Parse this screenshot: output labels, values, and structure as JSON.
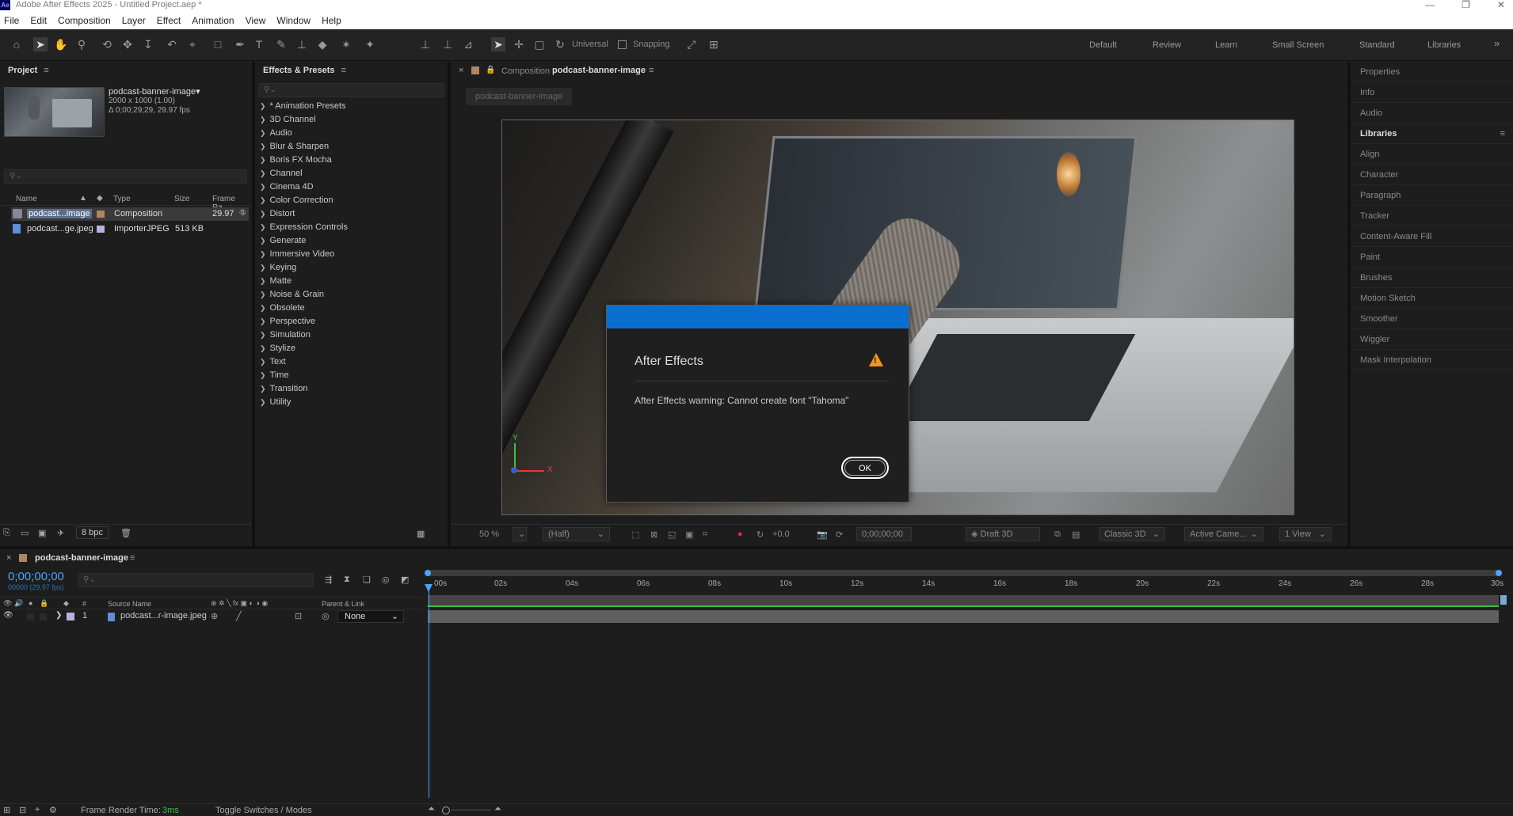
{
  "app": {
    "logo": "Ae",
    "title": "Adobe After Effects 2025 - Untitled Project.aep *",
    "window_controls": [
      "—",
      "❐",
      "✕"
    ]
  },
  "menu": [
    "File",
    "Edit",
    "Composition",
    "Layer",
    "Effect",
    "Animation",
    "View",
    "Window",
    "Help"
  ],
  "toolbar": {
    "universal_label": "Universal",
    "snapping_label": "Snapping",
    "workspaces": [
      "Default",
      "Review",
      "Learn",
      "Small Screen",
      "Standard",
      "Libraries"
    ],
    "more": "»"
  },
  "project_panel": {
    "title": "Project",
    "menu_icon": "≡",
    "selected_name": "podcast-banner-image▾",
    "selected_dims": "2000 x 1000 (1.00)",
    "selected_duration": "Δ 0;00;29;29, 29.97 fps",
    "search_placeholder": "⚲⌄",
    "columns": {
      "name": "Name",
      "type": "Type",
      "size": "Size",
      "frame_rate": "Frame Ra..."
    },
    "items": [
      {
        "name": "podcast...image",
        "type": "Composition",
        "size": "",
        "frame_rate": "29.97",
        "color": "#b0865d",
        "selected": true
      },
      {
        "name": "podcast...ge.jpeg",
        "type": "ImporterJPEG",
        "size": "513 KB",
        "frame_rate": "",
        "color": "#b7b1dd",
        "selected": false
      }
    ],
    "bpc": "8 bpc"
  },
  "effects_panel": {
    "title": "Effects & Presets",
    "menu_icon": "≡",
    "search_placeholder": "⚲⌄",
    "items": [
      "* Animation Presets",
      "3D Channel",
      "Audio",
      "Blur & Sharpen",
      "Boris FX Mocha",
      "Channel",
      "Cinema 4D",
      "Color Correction",
      "Distort",
      "Expression Controls",
      "Generate",
      "Immersive Video",
      "Keying",
      "Matte",
      "Noise & Grain",
      "Obsolete",
      "Perspective",
      "Simulation",
      "Stylize",
      "Text",
      "Time",
      "Transition",
      "Utility"
    ]
  },
  "composition_panel": {
    "close": "×",
    "lock": "🔒",
    "tab_prefix": "Composition",
    "tab_name": "podcast-banner-image",
    "menu_icon": "≡",
    "breadcrumb": "podcast-banner-image",
    "axis_y": "Y",
    "axis_x": "X",
    "footer": {
      "zoom": "50 %",
      "resolution": "(Half)",
      "exposure": "+0.0",
      "timecode": "0;00;00;00",
      "draft3d": "Draft 3D",
      "renderer": "Classic 3D",
      "camera": "Active Came...",
      "views": "1 View"
    }
  },
  "right_panel": {
    "items": [
      "Properties",
      "Info",
      "Audio",
      "Libraries",
      "Align",
      "Character",
      "Paragraph",
      "Tracker",
      "Content-Aware Fill",
      "Paint",
      "Brushes",
      "Motion Sketch",
      "Smoother",
      "Wiggler",
      "Mask Interpolation"
    ],
    "libraries_menu": "≡"
  },
  "dialog": {
    "title": "After Effects",
    "message": "After Effects warning: Cannot create font \"Tahoma\"",
    "ok_label": "OK",
    "warning_icon": "!"
  },
  "timeline": {
    "close": "×",
    "tab_name": "podcast-banner-image",
    "menu_icon": "≡",
    "timecode": "0;00;00;00",
    "timecode_sub": "00000 (29.97 fps)",
    "search_placeholder": "⚲⌄",
    "columns": {
      "num": "#",
      "source": "Source Name",
      "parent": "Parent & Link"
    },
    "layer": {
      "num": "1",
      "name": "podcast...r-image.jpeg",
      "parent": "None"
    },
    "ticks": [
      "00s",
      "02s",
      "04s",
      "06s",
      "08s",
      "10s",
      "12s",
      "14s",
      "16s",
      "18s",
      "20s",
      "22s",
      "24s",
      "26s",
      "28s",
      "30s"
    ],
    "status": {
      "render_label": "Frame Render Time:",
      "render_value": "3ms",
      "toggle": "Toggle Switches / Modes"
    }
  },
  "colors": {
    "accent_blue": "#0a6ed1",
    "timecode_blue": "#4aa3ff",
    "render_green": "#3fc23f",
    "warning_orange": "#f29423"
  }
}
